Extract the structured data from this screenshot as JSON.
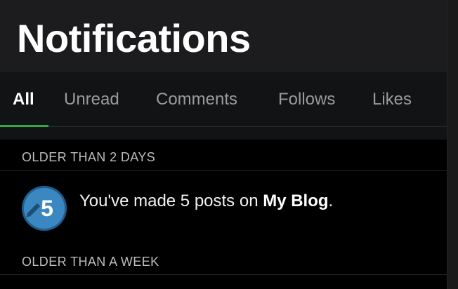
{
  "header": {
    "title": "Notifications"
  },
  "tabs": [
    {
      "label": "All",
      "active": true
    },
    {
      "label": "Unread",
      "active": false
    },
    {
      "label": "Comments",
      "active": false
    },
    {
      "label": "Follows",
      "active": false
    },
    {
      "label": "Likes",
      "active": false
    }
  ],
  "sections": [
    {
      "label": "OLDER THAN 2 DAYS",
      "items": [
        {
          "icon": "milestone-badge-icon",
          "badge_number": "5",
          "text_prefix": "You've made 5 posts on ",
          "site_name": "My Blog",
          "text_suffix": "."
        }
      ]
    },
    {
      "label": "OLDER THAN A WEEK",
      "items": []
    }
  ],
  "colors": {
    "accent": "#2eaa44",
    "badge_fill": "#3b87c1",
    "background": "#000000",
    "header_bg": "#1c1c1e",
    "tabs_bg": "#121314"
  }
}
